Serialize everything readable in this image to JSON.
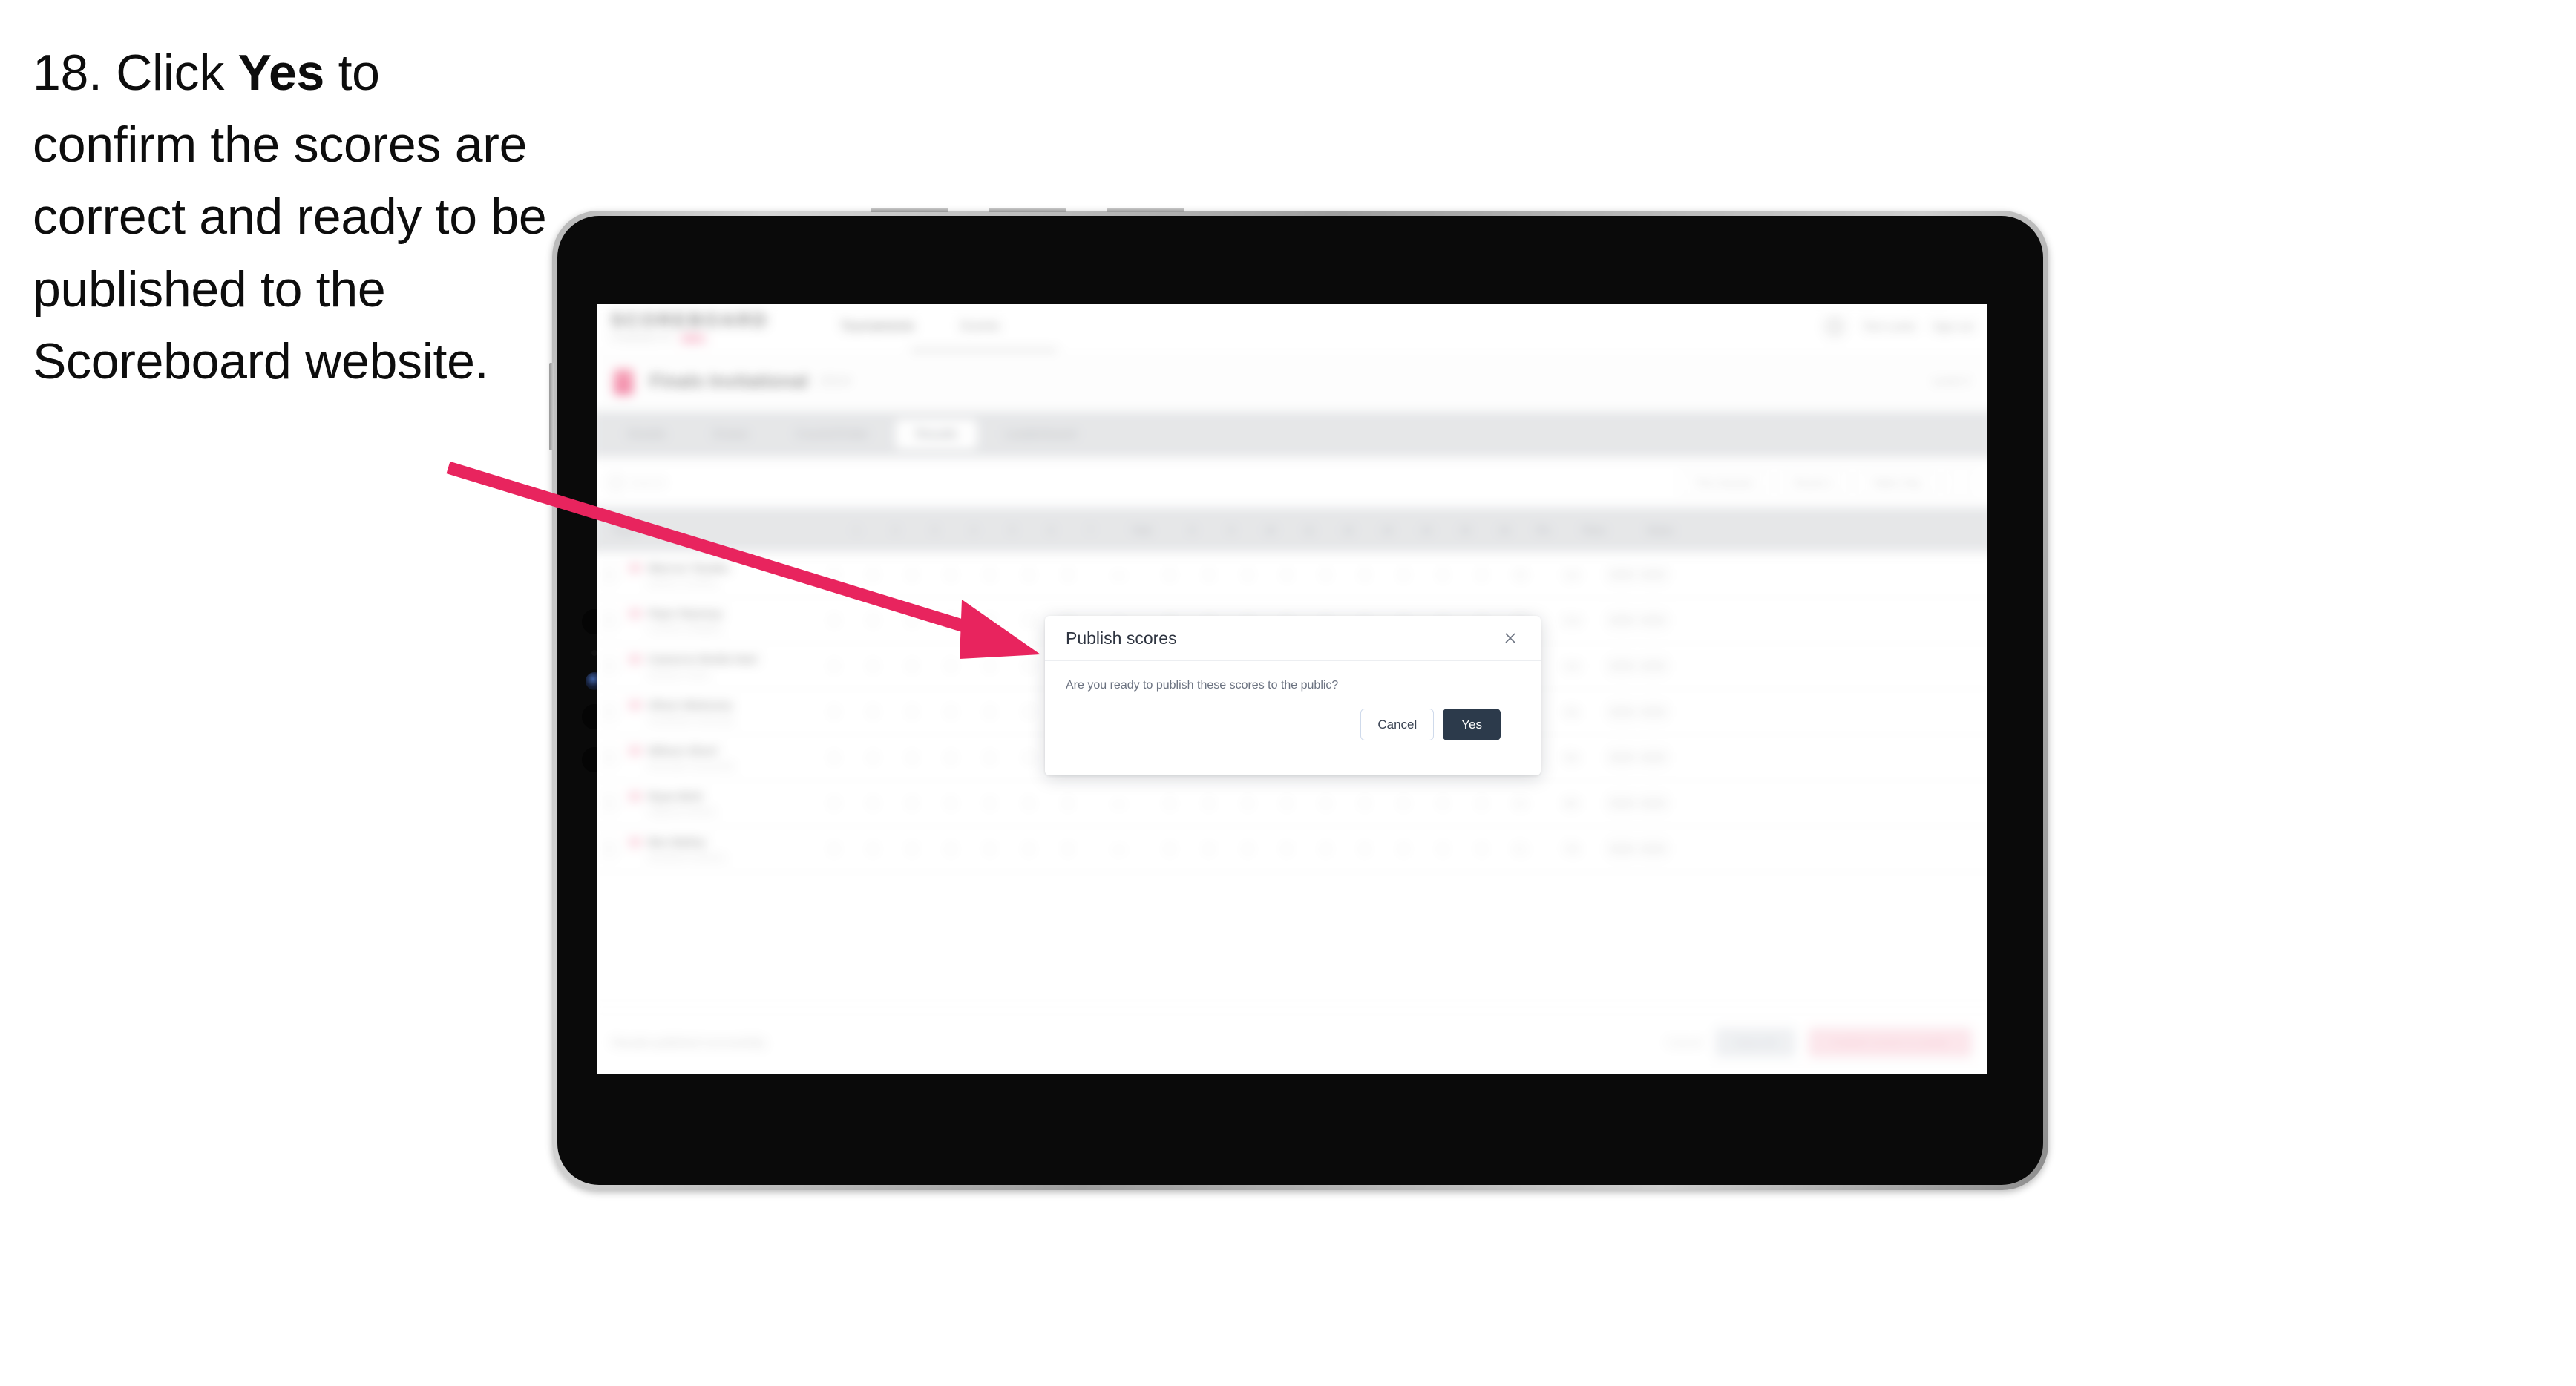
{
  "caption": {
    "step": "18. Click ",
    "bold": "Yes",
    "rest": " to confirm the scores are correct and ready to be published to the Scoreboard website."
  },
  "annotation": {
    "arrow_color": "#E8245E",
    "name": "pointer-arrow"
  },
  "device": {
    "type": "tablet",
    "bezel_color": "#0a0a0a",
    "frame_color": "#b9b9b9"
  },
  "app": {
    "header": {
      "brand_name": "SCOREBOARD",
      "brand_sub": "POWERED BY",
      "brand_badge": "BWF",
      "nav": [
        {
          "label": "Tournaments",
          "active": true
        },
        {
          "label": "Events",
          "active": false
        }
      ],
      "user_name": "Tom Lewis",
      "sign_out": "Sign out"
    },
    "competition": {
      "title": "Finals Invitational",
      "year": "2024",
      "right_meta": "Level 3"
    },
    "tabs": [
      {
        "label": "Details",
        "active": false
      },
      {
        "label": "Draws",
        "active": false
      },
      {
        "label": "Courts/Order",
        "active": false
      },
      {
        "label": "Results",
        "active": true
      },
      {
        "label": "Leaderboard",
        "active": false
      }
    ],
    "filters": {
      "search_placeholder": "Search",
      "buttons": [
        "This Session",
        "Round 1",
        "Table Only"
      ]
    },
    "table": {
      "columns": [
        "Player",
        "1",
        "2",
        "3",
        "4",
        "5",
        "6",
        "7",
        "Total",
        "8",
        "9",
        "10",
        "11",
        "12",
        "13",
        "14",
        "15",
        "16",
        "Pts",
        "Place",
        "Status"
      ],
      "rows": [
        {
          "name": "Marcus Tanaka",
          "club": "Eastern Combine",
          "place": "1st",
          "pts": "96",
          "status": "Final"
        },
        {
          "name": "Piper Ramsey",
          "club": "Coastal Collegiate",
          "place": "2nd",
          "pts": "94",
          "status": "Final"
        },
        {
          "name": "Cameron Bodie-Hart",
          "club": "Northern Union",
          "place": "3rd",
          "pts": "91",
          "status": "Final"
        },
        {
          "name": "Oliver Mokoena",
          "club": "Southbank University",
          "place": "4th",
          "pts": "89",
          "status": "Final"
        },
        {
          "name": "Wilson Short",
          "club": "Riverside Community",
          "place": "5th",
          "pts": "86",
          "status": "Final"
        },
        {
          "name": "Ryan Britt",
          "club": "Highland Athletic",
          "place": "6th",
          "pts": "84",
          "status": "Final"
        },
        {
          "name": "Ben Bailey",
          "club": "Westfield Academy",
          "place": "7th",
          "pts": "81",
          "status": "Final"
        }
      ]
    },
    "footer": {
      "note": "Results published successfully.",
      "link": "Cancel",
      "gray_button": "Save All",
      "pink_button": "Publish scores to public"
    }
  },
  "modal": {
    "title": "Publish scores",
    "message": "Are you ready to publish these scores to the public?",
    "close_icon": "×",
    "cancel_label": "Cancel",
    "yes_label": "Yes",
    "yes_color": "#2C3A4B"
  }
}
